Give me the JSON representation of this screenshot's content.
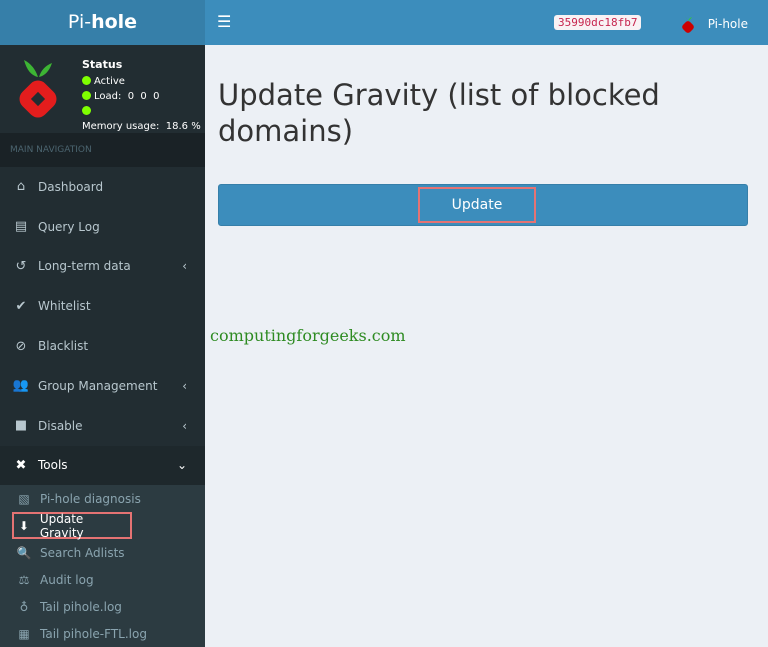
{
  "brand": {
    "prefix": "Pi-",
    "bold": "hole"
  },
  "topbar": {
    "hash": "35990dc18fb7",
    "user": "Pi-hole"
  },
  "status": {
    "title": "Status",
    "active": "Active",
    "load": "Load:  0  0  0",
    "memory": "Memory usage:  18.6 %"
  },
  "nav_header": "MAIN NAVIGATION",
  "nav": [
    {
      "label": "Dashboard",
      "icon": "⌂"
    },
    {
      "label": "Query Log",
      "icon": "▤"
    },
    {
      "label": "Long-term data",
      "icon": "↺",
      "chevron": "‹"
    },
    {
      "label": "Whitelist",
      "icon": "✔"
    },
    {
      "label": "Blacklist",
      "icon": "⊘"
    },
    {
      "label": "Group Management",
      "icon": "👥",
      "chevron": "‹"
    },
    {
      "label": "Disable",
      "icon": "■",
      "chevron": "‹"
    },
    {
      "label": "Tools",
      "icon": "✖",
      "chevron": "⌄"
    }
  ],
  "tools": [
    {
      "label": "Pi-hole diagnosis",
      "icon": "▧"
    },
    {
      "label": "Update Gravity",
      "icon": "⬇"
    },
    {
      "label": "Search Adlists",
      "icon": "🔍"
    },
    {
      "label": "Audit log",
      "icon": "⚖"
    },
    {
      "label": "Tail pihole.log",
      "icon": "♁"
    },
    {
      "label": "Tail pihole-FTL.log",
      "icon": "▦"
    }
  ],
  "main": {
    "title": "Update Gravity (list of blocked domains)",
    "button": "Update"
  },
  "watermark": "computingforgeeks.com"
}
